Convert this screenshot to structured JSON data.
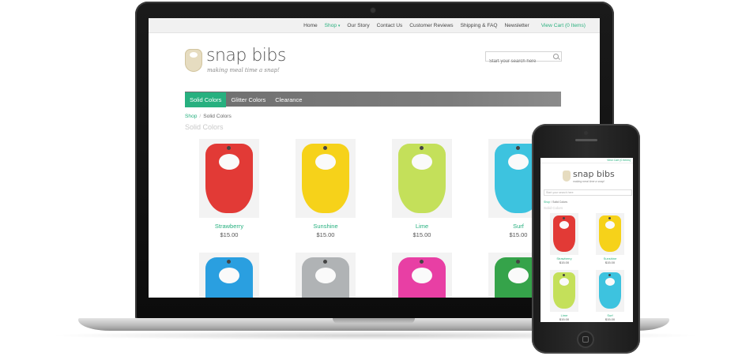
{
  "site": {
    "logo_text": "snap bibs",
    "tagline": "making meal time a snap!",
    "nav": [
      "Home",
      "Shop",
      "Our Story",
      "Contact Us",
      "Customer Reviews",
      "Shipping & FAQ",
      "Newsletter"
    ],
    "nav_active": "Shop",
    "cart": "View Cart (0 Items)",
    "search_placeholder": "Start your search here",
    "categories": [
      "Solid Colors",
      "Glitter Colors",
      "Clearance"
    ],
    "breadcrumb": {
      "shop": "Shop",
      "separator": "/",
      "current": "Solid Colors"
    },
    "section_title": "Solid Colors",
    "products": [
      {
        "name": "Strawberry",
        "price": "$15.00",
        "color": "#e23a36"
      },
      {
        "name": "Sunshine",
        "price": "$15.00",
        "color": "#f6d21a"
      },
      {
        "name": "Lime",
        "price": "$15.00",
        "color": "#c4e05a"
      },
      {
        "name": "Surf",
        "price": "$15.00",
        "color": "#3dc3df"
      },
      {
        "name": "",
        "price": "",
        "color": "#2a9fe0"
      },
      {
        "name": "",
        "price": "",
        "color": "#b0b3b5"
      },
      {
        "name": "",
        "price": "",
        "color": "#e83fa4"
      },
      {
        "name": "",
        "price": "",
        "color": "#35a34a"
      }
    ]
  },
  "mobile": {
    "cart": "View Cart (0 Items)",
    "logo_text": "snap bibs",
    "tagline": "making meal time a snap!",
    "search_placeholder": "Start your search here",
    "breadcrumb_shop": "Shop",
    "breadcrumb_current": "Solid Colors",
    "section_title": "Solid Colors",
    "products": [
      {
        "name": "Strawberry",
        "price": "$15.00",
        "color": "#e23a36"
      },
      {
        "name": "Sunshine",
        "price": "$15.00",
        "color": "#f6d21a"
      },
      {
        "name": "Lime",
        "price": "$15.00",
        "color": "#c4e05a"
      },
      {
        "name": "Surf",
        "price": "$15.00",
        "color": "#3dc3df"
      }
    ]
  },
  "colors": {
    "accent": "#27b07f",
    "catbar": "#777777"
  }
}
